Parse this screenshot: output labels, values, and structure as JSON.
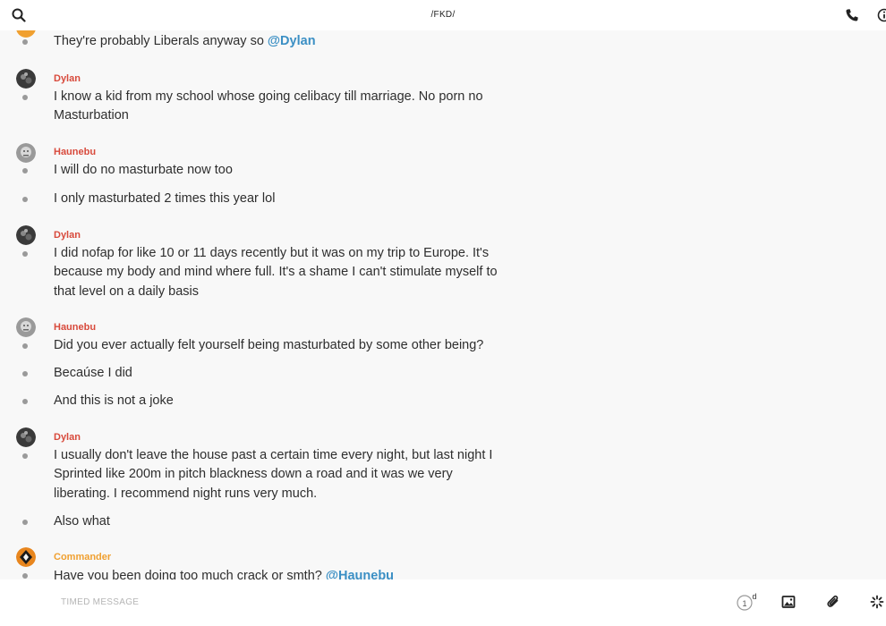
{
  "header": {
    "title": "/FKD/"
  },
  "colors": {
    "sender_red": "#d84a3c",
    "sender_orange": "#f0a030",
    "mention": "#3b8fc4"
  },
  "messages": {
    "m0": {
      "pre": "They're probably Liberals anyway so ",
      "mention": "@Dylan"
    },
    "g1": {
      "sender": "Dylan",
      "lines": [
        "I know a kid from my school whose going celibacy till marriage. No porn no Masturbation"
      ]
    },
    "g2": {
      "sender": "Haunebu",
      "lines": [
        "I will do no masturbate now too",
        "I only masturbated 2 times this year lol"
      ]
    },
    "g3": {
      "sender": "Dylan",
      "lines": [
        "I did nofap for like 10 or 11 days recently but it was on my trip to Europe. It's because my body and mind where full. It's a shame I can't stimulate myself to that level on a daily basis"
      ]
    },
    "g4": {
      "sender": "Haunebu",
      "lines": [
        "Did you ever actually felt yourself being masturbated by some other being?",
        "Becaúse I did",
        "And this is not a joke"
      ]
    },
    "g5": {
      "sender": "Dylan",
      "lines": [
        "I usually don't leave the house past a certain time every night, but last night I Sprinted like 200m in pitch blackness down a road and it was we very liberating. I recommend night runs very much.",
        "Also what"
      ]
    },
    "g6": {
      "sender": "Commander",
      "pre": "Have you been doing too much crack or smth? ",
      "mention": "@Haunebu"
    }
  },
  "composer": {
    "placeholder": "TIMED MESSAGE",
    "ttl_value": "1",
    "ttl_unit": "d"
  }
}
